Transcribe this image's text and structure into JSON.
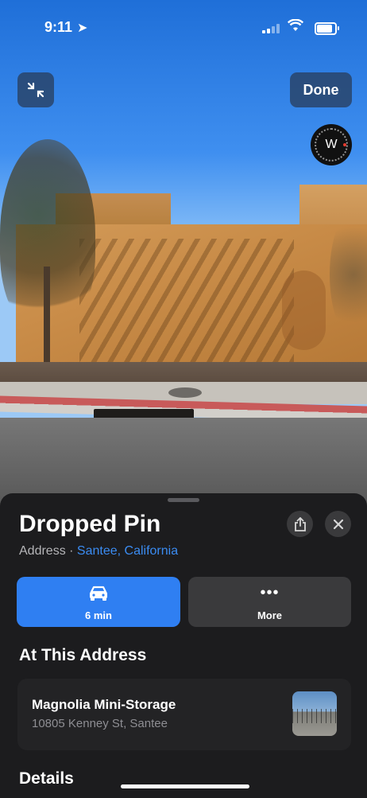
{
  "status_bar": {
    "time": "9:11",
    "location_glyph": "➤"
  },
  "camera_view": {
    "done_label": "Done",
    "compass_heading": "W"
  },
  "place_card": {
    "title": "Dropped Pin",
    "address_prefix": "Address · ",
    "location_link": "Santee, California",
    "actions": {
      "directions_label": "6 min",
      "directions_icon": "car-icon",
      "more_label": "More",
      "more_icon": "ellipsis-icon"
    },
    "at_address_heading": "At This Address",
    "business": {
      "name": "Magnolia Mini-Storage",
      "address": "10805 Kenney St, Santee"
    },
    "details_heading": "Details"
  },
  "colors": {
    "accent": "#2f7ff2",
    "link": "#3b8cf2",
    "sheet_bg": "#1c1c1e"
  }
}
